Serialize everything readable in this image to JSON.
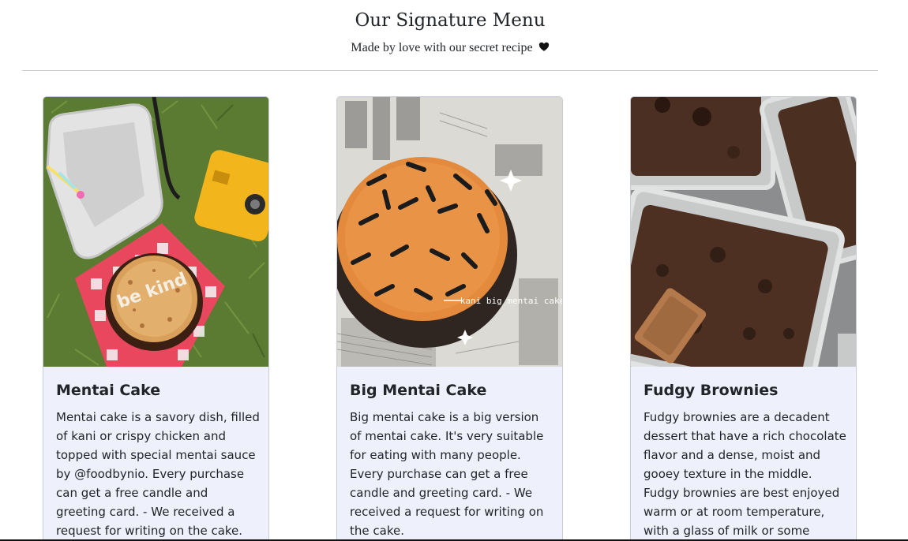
{
  "header": {
    "title": "Our Signature Menu",
    "subtitle": "Made by love with our secret recipe",
    "subtitle_icon": "heart-icon"
  },
  "cards": [
    {
      "title": "Mentai Cake",
      "text": "Mentai cake is a savory dish, filled of kani or crispy chicken and topped with special mentai sauce by @foodbynio. Every purchase can get a free candle and greeting card. - We received a request for writing on the cake.",
      "image_text": "be kind"
    },
    {
      "title": "Big Mentai Cake",
      "text": "Big mentai cake is a big version of mentai cake. It's very suitable for eating with many people. Every purchase can get a free candle and greeting card. - We received a request for writing on the cake.",
      "image_text": "kani big mentai cake"
    },
    {
      "title": "Fudgy Brownies",
      "text": "Fudgy brownies are a decadent dessert that have a rich chocolate flavor and a dense, moist and gooey texture in the middle. Fudgy brownies are best enjoyed warm or at room temperature, with a glass of milk or some whipped cream or",
      "image_text": ""
    }
  ],
  "colors": {
    "card_bg": "#eef1fb",
    "card_border": "#c9cbd6",
    "text": "#212529"
  }
}
